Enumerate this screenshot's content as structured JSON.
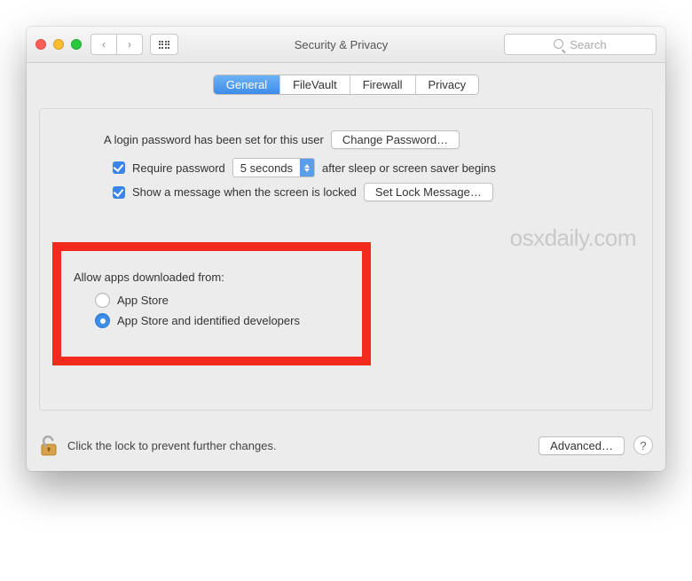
{
  "window": {
    "title": "Security & Privacy"
  },
  "search": {
    "placeholder": "Search"
  },
  "tabs": {
    "general": "General",
    "filevault": "FileVault",
    "firewall": "Firewall",
    "privacy": "Privacy"
  },
  "login": {
    "password_set": "A login password has been set for this user",
    "change_password_btn": "Change Password…",
    "require_label": "Require password",
    "delay_value": "5 seconds",
    "after_sleep": "after sleep or screen saver begins",
    "show_message_label": "Show a message when the screen is locked",
    "set_lock_message_btn": "Set Lock Message…"
  },
  "watermark": "osxdaily.com",
  "allow": {
    "title": "Allow apps downloaded from:",
    "option1": "App Store",
    "option2": "App Store and identified developers"
  },
  "footer": {
    "lock_text": "Click the lock to prevent further changes.",
    "advanced_btn": "Advanced…",
    "help": "?"
  }
}
